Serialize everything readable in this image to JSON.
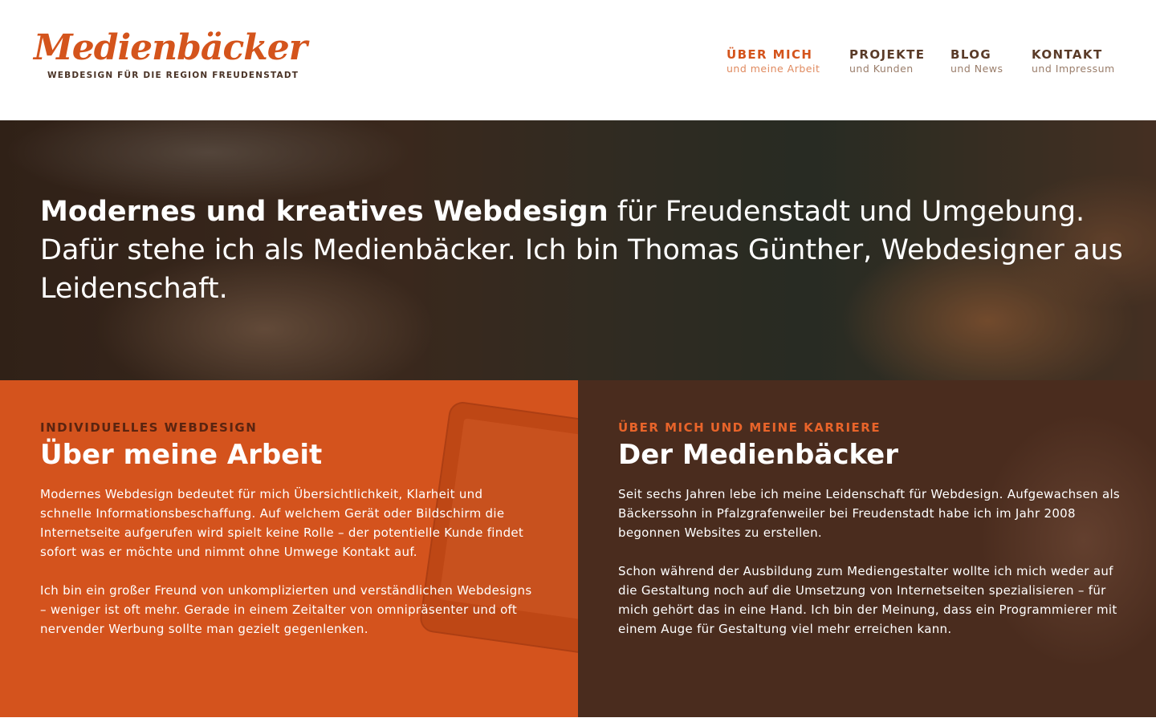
{
  "brand": {
    "name": "Medienbäcker",
    "tagline": "WEBDESIGN FÜR DIE REGION FREUDENSTADT"
  },
  "nav": {
    "items": [
      {
        "title": "ÜBER MICH",
        "subtitle": "und meine Arbeit",
        "active": true
      },
      {
        "title": "PROJEKTE",
        "subtitle": "und Kunden",
        "active": false
      },
      {
        "title": "BLOG",
        "subtitle": "und News",
        "active": false
      },
      {
        "title": "KONTAKT",
        "subtitle": "und Impressum",
        "active": false
      }
    ]
  },
  "hero": {
    "text_bold": "Modernes und kreatives Webdesign",
    "text_rest": " für Freudenstadt und Umgebung. Dafür stehe ich als Medienbäcker. Ich bin Thomas Günther, Webdesigner aus Leidenschaft."
  },
  "sections": [
    {
      "eyebrow": "INDIVIDUELLES WEBDESIGN",
      "heading": "Über meine Arbeit",
      "paragraphs": [
        "Modernes Webdesign bedeutet für mich Übersichtlichkeit, Klarheit und schnelle Informationsbeschaffung. Auf welchem Gerät oder Bildschirm die Internetseite aufgerufen wird spielt keine Rolle – der potentielle Kunde findet sofort was er möchte und nimmt ohne Umwege Kontakt auf.",
        "Ich bin ein großer Freund von unkomplizierten und verständlichen Webdesigns – weniger ist oft mehr. Gerade in einem Zeitalter von omnipräsenter und oft nervender Werbung sollte man gezielt gegenlenken."
      ]
    },
    {
      "eyebrow": "ÜBER MICH UND MEINE KARRIERE",
      "heading": "Der Medienbäcker",
      "paragraphs": [
        "Seit sechs Jahren lebe ich meine Leidenschaft für Webdesign. Aufgewachsen als Bäckerssohn in Pfalzgrafenweiler bei Freudenstadt habe ich im Jahr 2008 begonnen Websites zu erstellen.",
        "Schon während der Ausbildung zum Mediengestalter wollte ich mich weder auf die Gestaltung noch auf die Umsetzung von Internetseiten spezialisieren – für mich gehört das in eine Hand. Ich bin der Meinung, dass ein Programmierer mit einem Auge für Gestaltung viel mehr erreichen kann."
      ]
    }
  ],
  "colors": {
    "accent_orange": "#d4541c",
    "dark_brown": "#4a2c1e",
    "nav_brown": "#5a3b28"
  }
}
